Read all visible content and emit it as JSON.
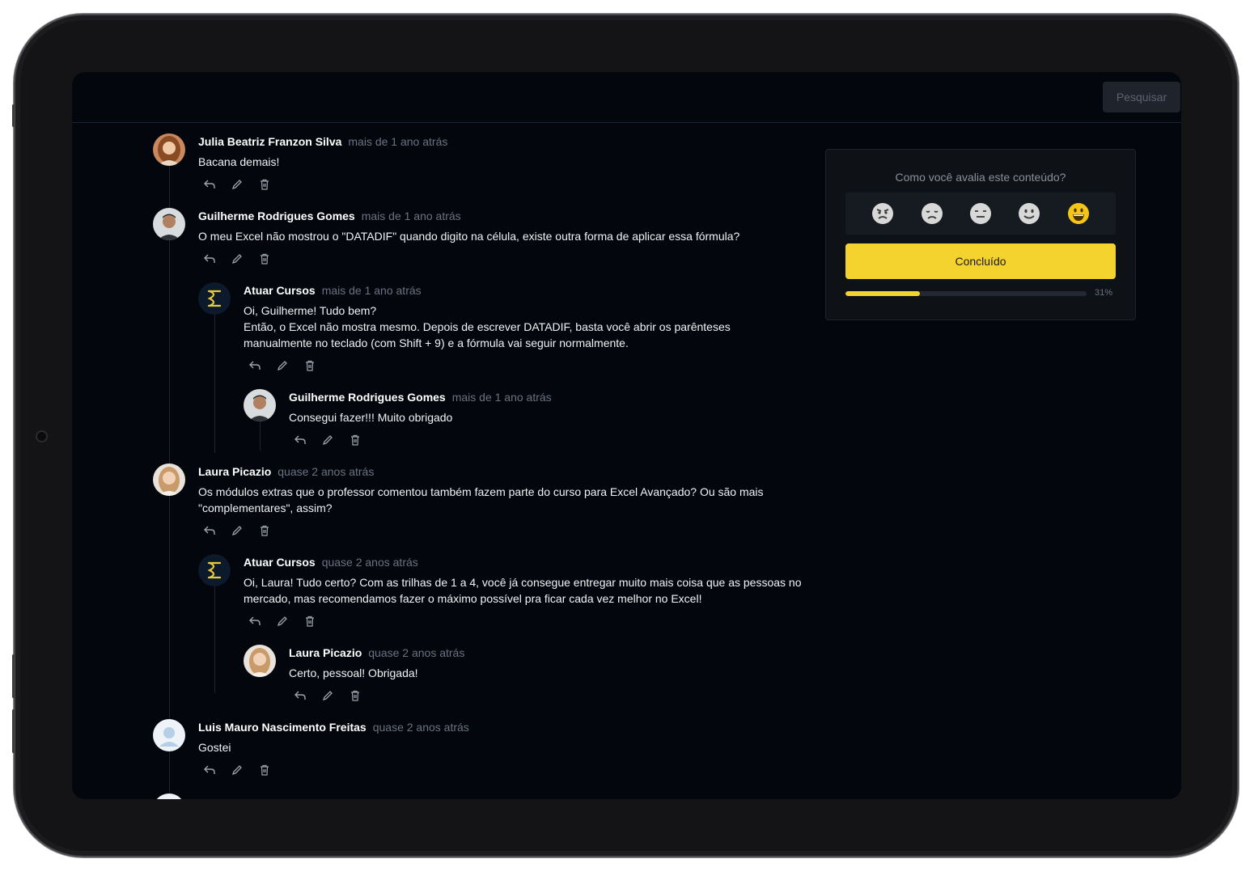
{
  "topbar": {
    "search_label": "Pesquisar"
  },
  "comments": [
    {
      "author": "Julia Beatriz Franzon Silva",
      "time": "mais de 1 ano atrás",
      "text": "Bacana demais!",
      "avatar": "photo-woman-icon"
    },
    {
      "author": "Guilherme Rodrigues Gomes",
      "time": "mais de 1 ano atrás",
      "text": "O meu Excel não mostrou o \"DATADIF\" quando digito na célula, existe outra forma de aplicar essa fórmula?",
      "avatar": "photo-man-icon"
    },
    {
      "author": "Atuar Cursos",
      "time": "mais de 1 ano atrás",
      "text_line1": "Oi, Guilherme! Tudo bem?",
      "text_line2": "Então, o Excel não mostra mesmo. Depois de escrever DATADIF, basta você abrir os parênteses manualmente no teclado (com Shift + 9) e a fórmula vai seguir normalmente.",
      "avatar": "atuar-logo-icon"
    },
    {
      "author": "Guilherme Rodrigues Gomes",
      "time": "mais de 1 ano atrás",
      "text": "Consegui fazer!!! Muito obrigado",
      "avatar": "photo-man-icon"
    },
    {
      "author": "Laura Picazio",
      "time": "quase 2 anos atrás",
      "text": "Os módulos extras que o professor comentou também fazem parte do curso para Excel Avançado? Ou são mais \"complementares\", assim?",
      "avatar": "photo-woman-icon"
    },
    {
      "author": "Atuar Cursos",
      "time": "quase 2 anos atrás",
      "text": "Oi, Laura! Tudo certo? Com as trilhas de 1 a 4, você já consegue entregar muito mais coisa que as pessoas no mercado, mas recomendamos fazer o máximo possível pra ficar cada vez melhor no Excel!",
      "avatar": "atuar-logo-icon"
    },
    {
      "author": "Laura Picazio",
      "time": "quase 2 anos atrás",
      "text": "Certo, pessoal! Obrigada!",
      "avatar": "photo-woman-icon"
    },
    {
      "author": "Luis Mauro Nascimento Freitas",
      "time": "quase 2 anos atrás",
      "text": "Gostei",
      "avatar": "default-user-icon"
    }
  ],
  "rating": {
    "question": "Como você avalia este conteúdo?",
    "emojis": [
      "angry-face-icon",
      "sad-face-icon",
      "neutral-face-icon",
      "smile-face-icon",
      "grin-face-icon"
    ],
    "selected": "grin-face-icon",
    "button_label": "Concluído",
    "progress_percent": 31,
    "progress_label": "31%"
  },
  "colors": {
    "accent": "#f5d32e",
    "background": "#03060c",
    "card": "#0e1116"
  }
}
